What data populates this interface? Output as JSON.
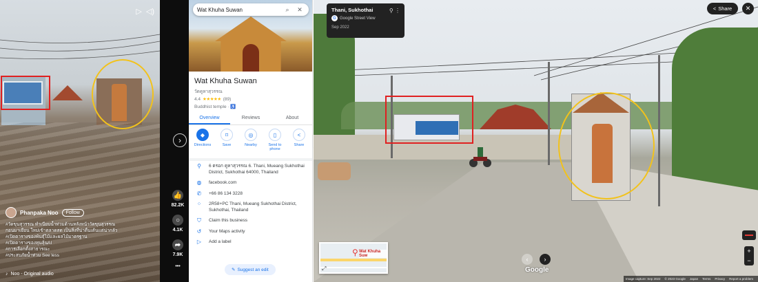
{
  "video": {
    "username": "Phanpaka Noo",
    "follow_label": "Follow",
    "caption_lines": [
      "#วัดขุนสุวรรณ ทำเนียบน้ำท่วมด้านหลังหน้าวัดขุนสุวรรณ",
      "กอนมาเยือน ใหม่เข้าตลาดสด เป็นสิ่งที่น่าตื่นเต้นแต่น่ากลัว",
      "#เปิดตารางของพันธุ์ไม้และผลไม้มาตรฐาน",
      "#เปิดตารางของทุนลุ้นAI",
      "#การเลือกตั้งสาธารณะ",
      "#ประสบภัยน้ำท่วม See less"
    ],
    "audio_label": "Noo - Original audio",
    "stats": [
      {
        "icon": "thumbs-up-icon",
        "value": "82.2K"
      },
      {
        "icon": "comment-icon",
        "value": "4.1K"
      },
      {
        "icon": "share-icon",
        "value": "7.9K"
      }
    ],
    "more": "•••"
  },
  "maps": {
    "search_value": "Wat Khuha Suwan",
    "place_name": "Wat Khuha Suwan",
    "place_name_local": "วัดคูหาสุวรรณ",
    "rating": "4.4",
    "stars": "★★★★★",
    "review_count": "(89)",
    "category": "Buddhist temple · ♿",
    "tabs": [
      "Overview",
      "Reviews",
      "About"
    ],
    "actions": [
      {
        "icon": "directions-icon",
        "glyph": "◆",
        "label": "Directions"
      },
      {
        "icon": "save-icon",
        "glyph": "⌑",
        "label": "Save"
      },
      {
        "icon": "nearby-icon",
        "glyph": "◎",
        "label": "Nearby"
      },
      {
        "icon": "send-to-phone-icon",
        "glyph": "▯",
        "label": "Send to phone"
      },
      {
        "icon": "share-icon",
        "glyph": "<",
        "label": "Share"
      }
    ],
    "info": [
      {
        "icon": "location-pin-icon",
        "glyph": "⚲",
        "text": "6 ตรอก คูหาสุวรรณ 6. Thani, Mueang Sukhothai District, Sukhothai 64000, Thailand"
      },
      {
        "icon": "globe-icon",
        "glyph": "◍",
        "text": "facebook.com"
      },
      {
        "icon": "phone-icon",
        "glyph": "✆",
        "text": "+66 86 134 3228"
      },
      {
        "icon": "plus-code-icon",
        "glyph": "⁘",
        "text": "2R58+PC Thani, Mueang Sukhothai District, Sukhothai, Thailand"
      },
      {
        "icon": "claim-shield-icon",
        "glyph": "⛉",
        "text": "Claim this business"
      },
      {
        "icon": "maps-activity-icon",
        "glyph": "↺",
        "text": "Your Maps activity"
      },
      {
        "icon": "label-icon",
        "glyph": "▷",
        "text": "Add a label"
      }
    ],
    "suggest_edit": "Suggest an edit"
  },
  "streetview": {
    "location": "Thani, Sukhothai",
    "provider": "Google Street View",
    "date": "Sep 2022",
    "share_label": "Share",
    "minimap_label": "Wat Khuha Suw",
    "google_logo": "Google",
    "footer": [
      "Image capture: Sep 2022",
      "© 2023 Google",
      "Japan",
      "Terms",
      "Privacy",
      "Report a problem"
    ]
  },
  "colors": {
    "annotation_box": "#e02020",
    "annotation_oval": "#f2c21b",
    "maps_accent": "#1a73e8"
  }
}
